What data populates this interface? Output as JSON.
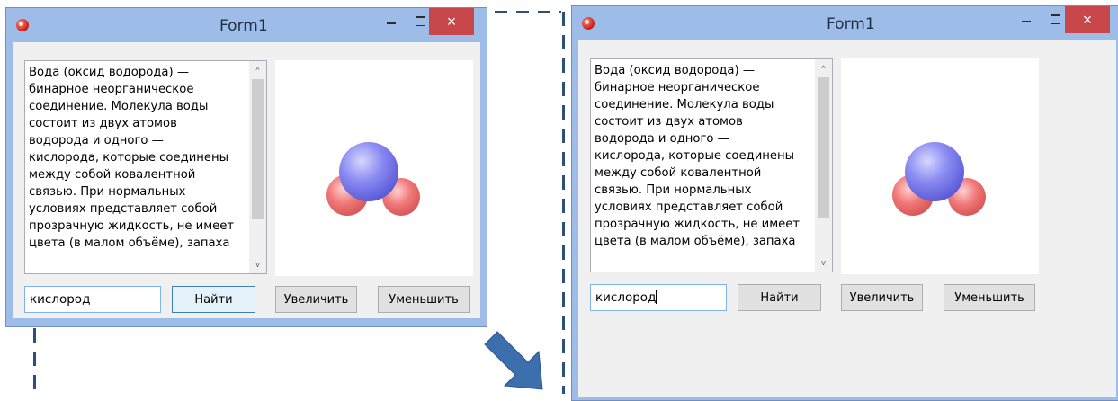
{
  "colors": {
    "accent": "#2e4f78",
    "close_button": "#c7474a",
    "arrow": "#3d6fae"
  },
  "left_window": {
    "title": "Form1",
    "close_glyph": "×",
    "description": "Вода (оксид водорода) —\nбинарное неорганическое\nсоединение. Молекула воды\nсостоит из двух атомов\nводорода и одного —\nкислорода, которые соединены\nмежду собой ковалентной\nсвязью. При нормальных\nусловиях представляет собой\nпрозрачную жидкость, не имеет\nцвета (в малом объёме), запаха\n ",
    "search_value": "кислород",
    "find_button": "Найти",
    "zoom_in_button": "Увеличить",
    "zoom_out_button": "Уменьшить"
  },
  "right_window": {
    "title": "Form1",
    "close_glyph": "×",
    "description": "Вода (оксид водорода) —\nбинарное неорганическое\nсоединение. Молекула воды\nсостоит из двух атомов\nводорода и одного —\nкислорода, которые соединены\nмежду собой ковалентной\nсвязью. При нормальных\nусловиях представляет собой\nпрозрачную жидкость, не имеет\nцвета (в малом объёме), запаха\n ",
    "search_value": "кислород",
    "find_button": "Найти",
    "zoom_in_button": "Увеличить",
    "zoom_out_button": "Уменьшить"
  },
  "scroll_up_glyph": "^",
  "scroll_down_glyph": "v",
  "icons": [
    "app-icon",
    "minimize-icon",
    "maximize-icon",
    "close-icon",
    "molecule-image",
    "arrow-icon"
  ]
}
